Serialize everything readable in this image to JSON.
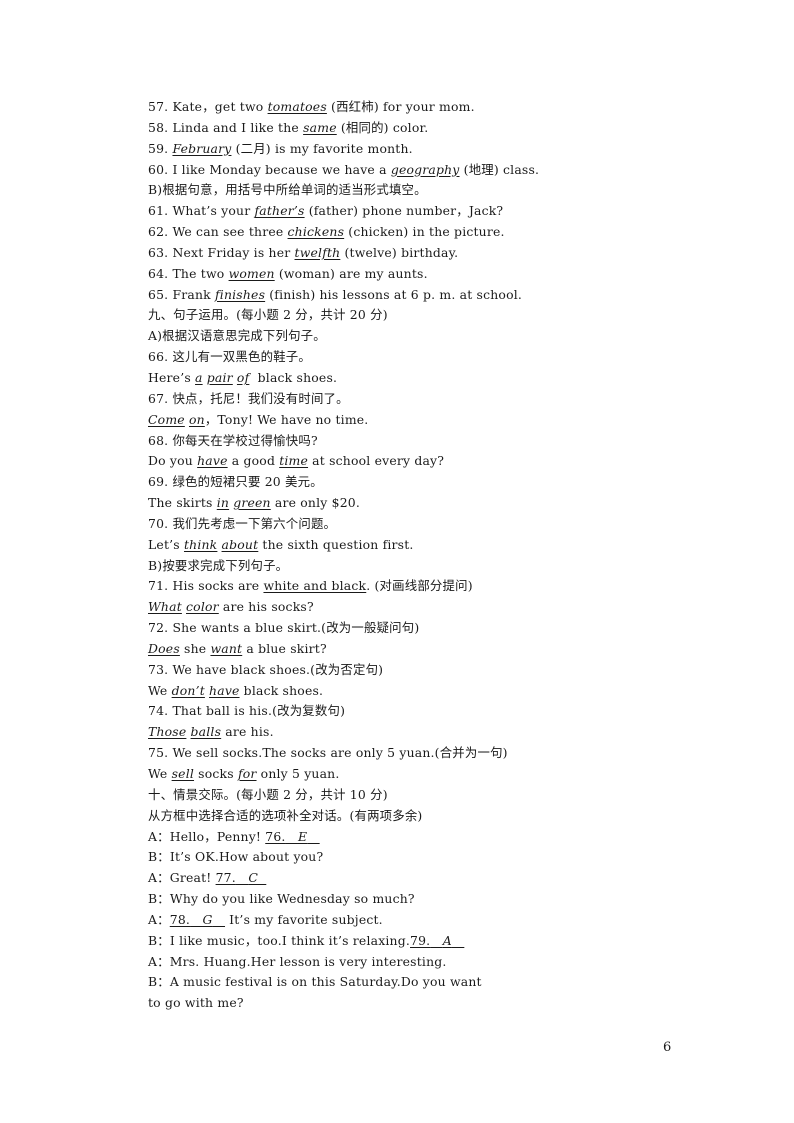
{
  "section_a_items": [
    {
      "num": "57. ",
      "pre": "Kate，get two ",
      "answer": "tomatoes",
      "post": " (西红柿) for your mom."
    },
    {
      "num": "58. ",
      "pre": "Linda and I like the ",
      "answer": "same",
      "post": " (相同的) color."
    },
    {
      "num": "59. ",
      "pre": "",
      "answer": "February",
      "post": " (二月) is my favorite month."
    },
    {
      "num": "60. ",
      "pre": "I like Monday because we have a ",
      "answer": "geography",
      "post": " (地理) class."
    }
  ],
  "section_b_title": "B)根据句意，用括号中所给单词的适当形式填空。",
  "section_b_items": [
    {
      "num": "61. ",
      "pre": "What’s your ",
      "answer": "father’s",
      "post": " (father) phone number，Jack?"
    },
    {
      "num": "62. ",
      "pre": "We can see three ",
      "answer": "chickens",
      "post": " (chicken) in the picture."
    },
    {
      "num": "63. ",
      "pre": "Next Friday is her ",
      "answer": "twelfth",
      "post": " (twelve) birthday."
    },
    {
      "num": "64. ",
      "pre": "The two ",
      "answer": "women",
      "post": " (woman) are my aunts."
    },
    {
      "num": "65. ",
      "pre": "Frank ",
      "answer": "finishes",
      "post": " (finish) his lessons at 6 p. m. at school."
    }
  ],
  "part9": {
    "title": "九、句子运用。(每小题 2 分，共计 20 分)",
    "sub_a_title": "A)根据汉语意思完成下列句子。",
    "q66": {
      "prompt": "66. 这儿有一双黑色的鞋子。",
      "pre": "Here’s ",
      "a1": "a",
      "a2": "pair",
      "a3": "of",
      "post": "  black shoes."
    },
    "q67": {
      "prompt": "67. 快点，托尼！我们没有时间了。",
      "a1": "Come",
      "a2": "on",
      "post": "，Tony! We have no time."
    },
    "q68": {
      "prompt": "68. 你每天在学校过得愉快吗?",
      "pre": "Do you ",
      "a1": "have",
      "mid": " a good ",
      "a2": "time",
      "post": " at school every day?"
    },
    "q69": {
      "prompt": "69. 绿色的短裙只要 20 美元。",
      "pre": "The skirts ",
      "a1": "in",
      "a2": "green",
      "post": " are only $20."
    },
    "q70": {
      "prompt": "70. 我们先考虑一下第六个问题。",
      "pre": "Let’s ",
      "a1": "think",
      "a2": "about",
      "post": " the sixth question first."
    },
    "sub_b_title": "B)按要求完成下列句子。",
    "q71": {
      "pre": "71. His socks are ",
      "underlined": "white and black",
      "post": ". (对画线部分提问)",
      "a1": "What",
      "a2": "color",
      "ans_post": " are his socks?"
    },
    "q72": {
      "prompt": "72. She wants a blue skirt.(改为一般疑问句)",
      "a1": "Does",
      "mid": " she ",
      "a2": "want",
      "post": " a blue skirt?"
    },
    "q73": {
      "prompt": "73. We have black shoes.(改为否定句)",
      "pre": "We ",
      "a1": "don’t",
      "a2": "have",
      "post": " black shoes."
    },
    "q74": {
      "prompt": "74. That ball is his.(改为复数句)",
      "a1": "Those",
      "a2": "balls",
      "post": " are his."
    },
    "q75": {
      "prompt": "75. We sell socks.The socks are only 5 yuan.(合并为一句)",
      "pre": "We ",
      "a1": "sell",
      "mid": " socks ",
      "a2": "for",
      "post": " only 5 yuan."
    }
  },
  "part10": {
    "title": "十、情景交际。(每小题 2 分，共计 10 分)",
    "instruction": "从方框中选择合适的选项补全对话。(有两项多余)",
    "dialogue": [
      {
        "pre": "A：Hello，Penny! ",
        "blank_num": "76.",
        "answer": "E",
        "post": ""
      },
      {
        "pre": "B：It’s OK.How about you?",
        "blank_num": "",
        "answer": "",
        "post": ""
      },
      {
        "pre": "A：Great! ",
        "blank_num": "77.",
        "answer": "C",
        "post": ""
      },
      {
        "pre": "B：Why do you like Wednesday so much?",
        "blank_num": "",
        "answer": "",
        "post": ""
      },
      {
        "pre": "A：",
        "blank_num": "78.",
        "answer": "G",
        "post": " It’s my favorite subject."
      },
      {
        "pre": "B：I like music，too.I think it’s relaxing.",
        "blank_num": "79.",
        "answer": "A",
        "post": ""
      },
      {
        "pre": "A：Mrs. Huang.Her lesson is very interesting.",
        "blank_num": "",
        "answer": "",
        "post": ""
      },
      {
        "pre": "B：A music festival is on this Saturday.Do you want",
        "blank_num": "",
        "answer": "",
        "post": ""
      },
      {
        "pre": "to go with me?",
        "blank_num": "",
        "answer": "",
        "post": ""
      }
    ]
  },
  "page_number": "6"
}
